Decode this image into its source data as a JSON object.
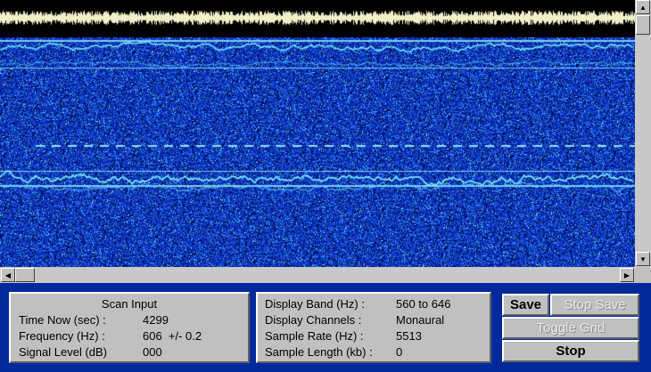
{
  "scan_panel": {
    "title": "Scan Input",
    "time_label": "Time Now (sec) :",
    "time_value": "4299",
    "freq_label": "Frequency (Hz) :",
    "freq_value": "606  +/- 0.2",
    "signal_label": "Signal Level (dB)",
    "signal_value": "000"
  },
  "display_panel": {
    "band_label": "Display Band (Hz) :",
    "band_value": "560 to 646",
    "channels_label": "Display Channels :",
    "channels_value": "Monaural",
    "rate_label": "Sample Rate (Hz) :",
    "rate_value": "5513",
    "length_label": "Sample Length (kb) :",
    "length_value": "0"
  },
  "buttons": {
    "save": "Save",
    "stop_save": "Stop Save",
    "toggle_grid": "Toggle Grid",
    "stop": "Stop"
  },
  "icons": {
    "scroll_up": "arrow-up-icon",
    "scroll_down": "arrow-down-icon",
    "scroll_left": "arrow-left-icon",
    "scroll_right": "arrow-right-icon"
  },
  "colors": {
    "background": "#002a9c",
    "spectrogram_base": "#0a2db8",
    "trace": "#6ff0ff",
    "panel": "#c0c0c0"
  }
}
